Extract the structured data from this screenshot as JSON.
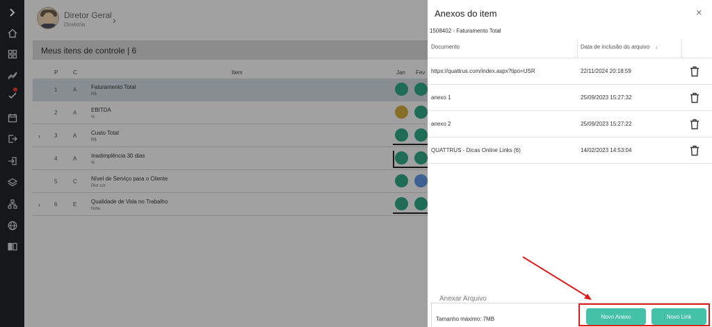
{
  "nav": {
    "items": [
      {
        "icon": "chevron-right-icon"
      },
      {
        "icon": "home-icon"
      },
      {
        "icon": "dashboard-icon"
      },
      {
        "icon": "trend-icon"
      },
      {
        "icon": "tasks-check-icon",
        "badge": true
      },
      {
        "icon": "calendar-icon"
      },
      {
        "icon": "exit-icon"
      },
      {
        "icon": "login-icon"
      },
      {
        "icon": "layers-icon"
      },
      {
        "icon": "sitemap-icon"
      },
      {
        "icon": "globe-icon"
      },
      {
        "icon": "book-icon"
      }
    ]
  },
  "user": {
    "name": "Diretor Geral",
    "department": "Diretoria"
  },
  "panel": {
    "title": "Meus itens de controle | 6",
    "headers": {
      "p": "P",
      "c": "C",
      "item": "Item",
      "jan": "Jan",
      "fev": "Fev"
    },
    "rows": [
      {
        "p": "1",
        "c": "A",
        "name": "Faturamento Total",
        "unit": "R$",
        "expandable": false,
        "selected": true,
        "dots": [
          "#2fa07f",
          "#2fa07f"
        ]
      },
      {
        "p": "2",
        "c": "A",
        "name": "EBITDA",
        "unit": "%",
        "expandable": false,
        "selected": false,
        "dots": [
          "#c7a43e",
          "#2fa07f"
        ]
      },
      {
        "p": "3",
        "c": "A",
        "name": "Custo Total",
        "unit": "R$",
        "expandable": true,
        "selected": false,
        "dots": [
          "#2fa07f",
          "#2fa07f"
        ]
      },
      {
        "p": "4",
        "c": "A",
        "name": "Inadimplência 30 dias",
        "unit": "%",
        "expandable": false,
        "selected": false,
        "dots": [
          "#2fa07f",
          "#2fa07f"
        ]
      },
      {
        "p": "5",
        "c": "C",
        "name": "Nível de Serviço para o Cliente",
        "unit": "Pior cor",
        "expandable": false,
        "selected": false,
        "dots": [
          "#2fa07f",
          "#5b8fd6"
        ]
      },
      {
        "p": "6",
        "c": "E",
        "name": "Qualidade de Vida no Trabalho",
        "unit": "Nota",
        "expandable": true,
        "selected": false,
        "dots": [
          "#2fa07f",
          "#2fa07f"
        ]
      }
    ]
  },
  "dialog": {
    "title": "Anexos do item",
    "close": "×",
    "subtitle": "1508402 - Faturamento Total",
    "columns": {
      "document": "Documento",
      "date": "Data de inclusão do arquivo",
      "sort": "↓"
    },
    "attachments": [
      {
        "document": "https://quattrus.com/index.aspx?tipo=USR",
        "date": "22/11/2024 20:18:59"
      },
      {
        "document": "anexo 1",
        "date": "25/09/2023 15:27:32"
      },
      {
        "document": "anexo 2",
        "date": "25/09/2023 15:27:22"
      },
      {
        "document": "QUATTRUS - Dicas Online Links (6)",
        "date": "14/02/2023 14:53:04"
      }
    ],
    "attach_section": {
      "legend": "Anexar Arquivo",
      "max_size": "Tamanho máximo: 7MB",
      "new_attachment": "Novo Anexo",
      "new_link": "Novo Link"
    }
  },
  "colors": {
    "accent": "#44c2a8",
    "highlight": "#e01b1b",
    "nav_bg": "#1f2329"
  }
}
